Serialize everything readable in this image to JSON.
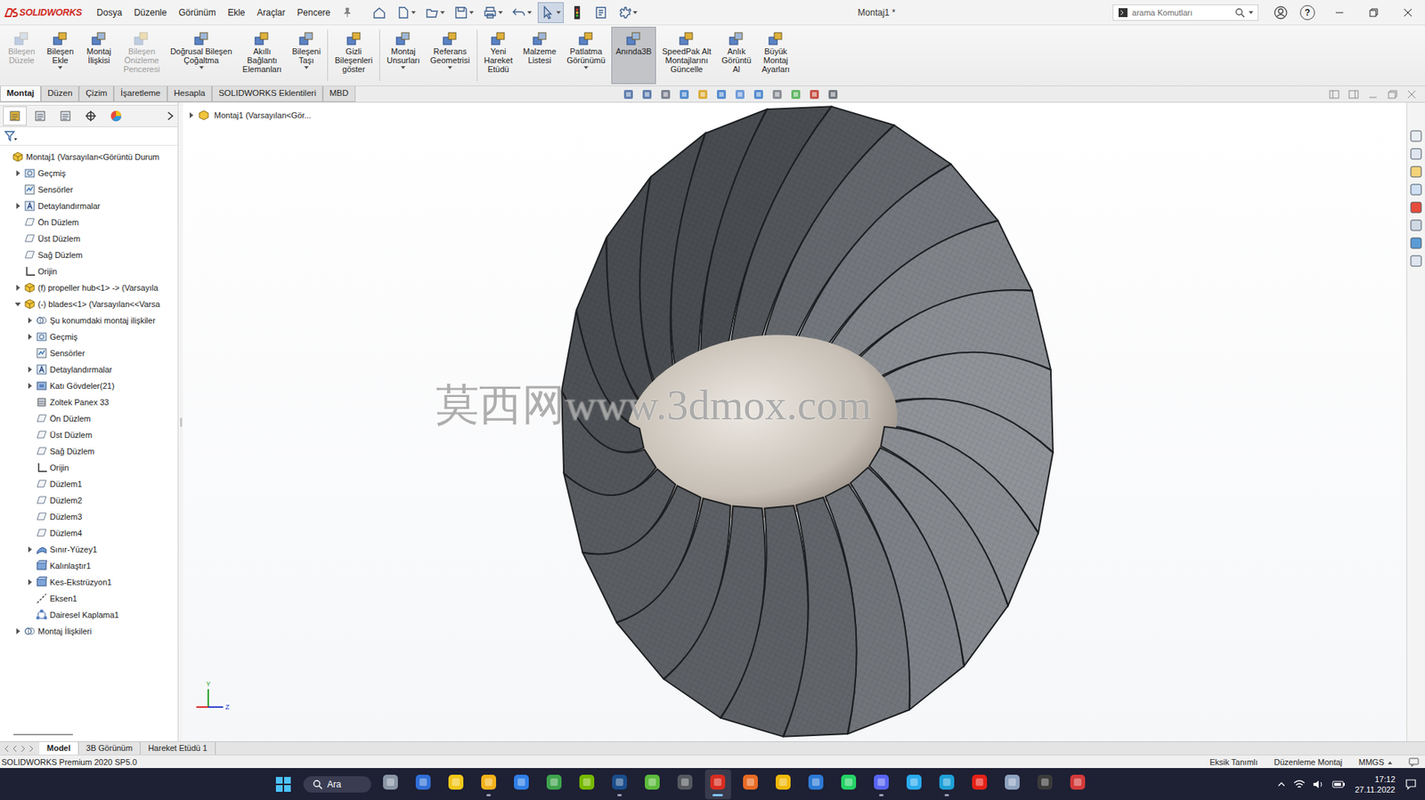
{
  "app": {
    "logo_text": "SOLIDWORKS",
    "menus": [
      "Dosya",
      "Düzenle",
      "Görünüm",
      "Ekle",
      "Araçlar",
      "Pencere"
    ],
    "title": "Montaj1 *",
    "search_placeholder": "arama Komutları",
    "help": "?"
  },
  "quick_access": [
    {
      "has_menu": false,
      "selected": false
    },
    {
      "has_menu": true,
      "selected": false
    },
    {
      "has_menu": true,
      "selected": false
    },
    {
      "has_menu": true,
      "selected": false
    },
    {
      "has_menu": true,
      "selected": false
    },
    {
      "has_menu": true,
      "selected": false
    },
    {
      "has_menu": true,
      "selected": true
    },
    {
      "has_menu": false,
      "selected": false
    },
    {
      "has_menu": false,
      "selected": false
    },
    {
      "has_menu": true,
      "selected": false
    }
  ],
  "ribbon": {
    "groups": [
      [
        {
          "lines": [
            "Bileşen",
            "Düzele"
          ],
          "disabled": true,
          "selected": false,
          "has_menu": false
        },
        {
          "lines": [
            "Bileşen",
            "Ekle"
          ],
          "disabled": false,
          "selected": false,
          "has_menu": true
        },
        {
          "lines": [
            "Montaj",
            "İlişkisi"
          ],
          "disabled": false,
          "selected": false,
          "has_menu": false
        },
        {
          "lines": [
            "Bileşen",
            "Önizleme",
            "Penceresi"
          ],
          "disabled": true,
          "selected": false,
          "has_menu": false
        },
        {
          "lines": [
            "Doğrusal Bileşen",
            "Çoğaltma"
          ],
          "disabled": false,
          "selected": false,
          "has_menu": true
        },
        {
          "lines": [
            "Akıllı",
            "Bağlantı",
            "Elemanları"
          ],
          "disabled": false,
          "selected": false,
          "has_menu": false
        },
        {
          "lines": [
            "Bileşeni",
            "Taşı"
          ],
          "disabled": false,
          "selected": false,
          "has_menu": true
        }
      ],
      [
        {
          "lines": [
            "Gizli",
            "Bileşenleri",
            "göster"
          ],
          "disabled": false,
          "selected": false,
          "has_menu": false
        }
      ],
      [
        {
          "lines": [
            "Montaj",
            "Unsurları"
          ],
          "disabled": false,
          "selected": false,
          "has_menu": true
        },
        {
          "lines": [
            "Referans",
            "Geometrisi"
          ],
          "disabled": false,
          "selected": false,
          "has_menu": true
        }
      ],
      [
        {
          "lines": [
            "Yeni",
            "Hareket",
            "Etüdü"
          ],
          "disabled": false,
          "selected": false,
          "has_menu": false
        },
        {
          "lines": [
            "Malzeme",
            "Listesi"
          ],
          "disabled": false,
          "selected": false,
          "has_menu": false
        },
        {
          "lines": [
            "Patlatma",
            "Görünümü"
          ],
          "disabled": false,
          "selected": false,
          "has_menu": true
        },
        {
          "lines": [
            "Anında3B"
          ],
          "disabled": false,
          "selected": true,
          "has_menu": false
        },
        {
          "lines": [
            "SpeedPak Alt",
            "Montajlarını",
            "Güncelle"
          ],
          "disabled": false,
          "selected": false,
          "has_menu": false
        },
        {
          "lines": [
            "Anlık",
            "Görüntü",
            "Al"
          ],
          "disabled": false,
          "selected": false,
          "has_menu": false
        },
        {
          "lines": [
            "Büyük",
            "Montaj",
            "Ayarları"
          ],
          "disabled": false,
          "selected": false,
          "has_menu": false
        }
      ]
    ]
  },
  "tabs": [
    {
      "label": "Montaj",
      "selected": true
    },
    {
      "label": "Düzen",
      "selected": false
    },
    {
      "label": "Çizim",
      "selected": false
    },
    {
      "label": "İşaretleme",
      "selected": false
    },
    {
      "label": "Hesapla",
      "selected": false
    },
    {
      "label": "SOLIDWORKS Eklentileri",
      "selected": false
    },
    {
      "label": "MBD",
      "selected": false
    }
  ],
  "panel_tabs": [
    {
      "selected": true
    },
    {
      "selected": false
    },
    {
      "selected": false
    },
    {
      "selected": false
    },
    {
      "selected": false
    }
  ],
  "tree": {
    "items": [
      {
        "label": "Montaj1  (Varsayılan<Görüntü Durum",
        "depth": 0,
        "expandable": false,
        "expanded": false,
        "kind": "assembly"
      },
      {
        "label": "Geçmiş",
        "depth": 1,
        "expandable": true,
        "expanded": false,
        "kind": "history"
      },
      {
        "label": "Sensörler",
        "depth": 1,
        "expandable": false,
        "expanded": false,
        "kind": "sensor"
      },
      {
        "label": "Detaylandırmalar",
        "depth": 1,
        "expandable": true,
        "expanded": false,
        "kind": "annotation"
      },
      {
        "label": "Ön Düzlem",
        "depth": 1,
        "expandable": false,
        "expanded": false,
        "kind": "plane"
      },
      {
        "label": "Üst Düzlem",
        "depth": 1,
        "expandable": false,
        "expanded": false,
        "kind": "plane"
      },
      {
        "label": "Sağ Düzlem",
        "depth": 1,
        "expandable": false,
        "expanded": false,
        "kind": "plane"
      },
      {
        "label": "Orijin",
        "depth": 1,
        "expandable": false,
        "expanded": false,
        "kind": "origin"
      },
      {
        "label": "(f) propeller hub<1> -> (Varsayıla",
        "depth": 1,
        "expandable": true,
        "expanded": false,
        "kind": "part"
      },
      {
        "label": "(-) blades<1> (Varsayılan<<Varsa",
        "depth": 1,
        "expandable": true,
        "expanded": true,
        "kind": "part"
      },
      {
        "label": "Şu konumdaki montaj ilişkiler",
        "depth": 2,
        "expandable": true,
        "expanded": false,
        "kind": "mates"
      },
      {
        "label": "Geçmiş",
        "depth": 2,
        "expandable": true,
        "expanded": false,
        "kind": "history"
      },
      {
        "label": "Sensörler",
        "depth": 2,
        "expandable": false,
        "expanded": false,
        "kind": "sensor"
      },
      {
        "label": "Detaylandırmalar",
        "depth": 2,
        "expandable": true,
        "expanded": false,
        "kind": "annotation"
      },
      {
        "label": "Katı Gövdeler(21)",
        "depth": 2,
        "expandable": true,
        "expanded": false,
        "kind": "bodies"
      },
      {
        "label": "Zoltek Panex 33",
        "depth": 2,
        "expandable": false,
        "expanded": false,
        "kind": "material"
      },
      {
        "label": "Ön Düzlem",
        "depth": 2,
        "expandable": false,
        "expanded": false,
        "kind": "plane"
      },
      {
        "label": "Üst Düzlem",
        "depth": 2,
        "expandable": false,
        "expanded": false,
        "kind": "plane"
      },
      {
        "label": "Sağ Düzlem",
        "depth": 2,
        "expandable": false,
        "expanded": false,
        "kind": "plane"
      },
      {
        "label": "Orijin",
        "depth": 2,
        "expandable": false,
        "expanded": false,
        "kind": "origin"
      },
      {
        "label": "Düzlem1",
        "depth": 2,
        "expandable": false,
        "expanded": false,
        "kind": "plane"
      },
      {
        "label": "Düzlem2",
        "depth": 2,
        "expandable": false,
        "expanded": false,
        "kind": "plane"
      },
      {
        "label": "Düzlem3",
        "depth": 2,
        "expandable": false,
        "expanded": false,
        "kind": "plane"
      },
      {
        "label": "Düzlem4",
        "depth": 2,
        "expandable": false,
        "expanded": false,
        "kind": "plane"
      },
      {
        "label": "Sınır-Yüzey1",
        "depth": 2,
        "expandable": true,
        "expanded": false,
        "kind": "surface"
      },
      {
        "label": "Kalınlaştır1",
        "depth": 2,
        "expandable": false,
        "expanded": false,
        "kind": "feature"
      },
      {
        "label": "Kes-Ekstrüzyon1",
        "depth": 2,
        "expandable": true,
        "expanded": false,
        "kind": "feature"
      },
      {
        "label": "Eksen1",
        "depth": 2,
        "expandable": false,
        "expanded": false,
        "kind": "axis"
      },
      {
        "label": "Dairesel Kaplama1",
        "depth": 2,
        "expandable": false,
        "expanded": false,
        "kind": "pattern"
      },
      {
        "label": "Montaj İlişkileri",
        "depth": 1,
        "expandable": true,
        "expanded": false,
        "kind": "mates"
      }
    ]
  },
  "viewport": {
    "breadcrumb": {
      "text": "Montaj1  (Varsayılan<Gör...",
      "expanded": false
    },
    "watermark": "莫西网www.3dmox.com",
    "axes": [
      "Y",
      "Z"
    ]
  },
  "bottom_tabs": [
    {
      "label": "Model",
      "selected": true
    },
    {
      "label": "3B Görünüm",
      "selected": false
    },
    {
      "label": "Hareket Etüdü 1",
      "selected": false
    }
  ],
  "status_bar": {
    "left": "SOLIDWORKS Premium 2020 SP5.0",
    "items": [
      {
        "text": "Eksik Tanımlı",
        "has_menu": false
      },
      {
        "text": "Düzenleme Montaj",
        "has_menu": false
      },
      {
        "text": "MMGS",
        "has_menu": true
      }
    ]
  },
  "taskbar": {
    "search": "Ara",
    "apps": [
      {
        "running": false,
        "active": false
      },
      {
        "running": false,
        "active": false
      },
      {
        "running": false,
        "active": false
      },
      {
        "running": true,
        "active": false
      },
      {
        "running": false,
        "active": false
      },
      {
        "running": false,
        "active": false
      },
      {
        "running": false,
        "active": false
      },
      {
        "running": true,
        "active": false
      },
      {
        "running": false,
        "active": false
      },
      {
        "running": false,
        "active": false
      },
      {
        "running": true,
        "active": true
      },
      {
        "running": false,
        "active": false
      },
      {
        "running": false,
        "active": false
      },
      {
        "running": false,
        "active": false
      },
      {
        "running": false,
        "active": false
      },
      {
        "running": true,
        "active": false
      },
      {
        "running": false,
        "active": false
      },
      {
        "running": true,
        "active": false
      },
      {
        "running": false,
        "active": false
      },
      {
        "running": false,
        "active": false
      },
      {
        "running": false,
        "active": false
      },
      {
        "running": false,
        "active": false
      }
    ],
    "time": "17:12",
    "date": "27.11.2022"
  }
}
